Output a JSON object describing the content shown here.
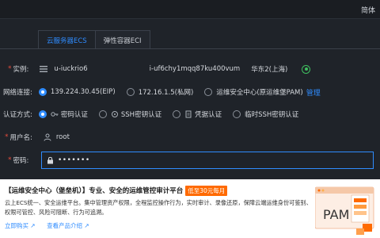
{
  "topbar": {
    "language": "简体"
  },
  "tabs": [
    {
      "label": "云服务器ECS",
      "active": true
    },
    {
      "label": "弹性容器ECI",
      "active": false
    }
  ],
  "instance": {
    "label": "实例:",
    "name": "u-iuckrio6",
    "id": "i-uf6chy1mqq87ku400vum",
    "region": "华东2(上海)"
  },
  "network": {
    "label": "网络连接:",
    "options": [
      {
        "text": "139.224.30.45(EIP)",
        "selected": true
      },
      {
        "text": "172.16.1.5(私网)",
        "selected": false
      },
      {
        "text": "运维安全中心(原运维堡PAM)",
        "selected": false
      }
    ],
    "manage_label": "管理"
  },
  "auth": {
    "label": "认证方式:",
    "options": [
      {
        "text": "密码认证",
        "selected": true
      },
      {
        "text": "SSH密钥认证",
        "selected": false
      },
      {
        "text": "凭据认证",
        "selected": false
      },
      {
        "text": "临时SSH密钥认证",
        "selected": false
      }
    ]
  },
  "user": {
    "label": "用户名:",
    "value": "root"
  },
  "password": {
    "label": "密码:",
    "value": "•••••••"
  },
  "banner": {
    "title": "【运维安全中心（堡垒机）】专业、安全的运维管控审计平台",
    "promo": "低至30元每月",
    "description": "云上ECS统一、安全运维平台。集中管理资产权限，全程监控操作行为，实时审计、录像还原，保障云端运维身份可鉴别、权限可管控、风险可阻断、行为可追溯。",
    "links": [
      "立即购买",
      "查看产品介绍"
    ]
  },
  "illustration": {
    "text": "PAM"
  },
  "colors": {
    "accent": "#2f8cff",
    "background": "#1f2329",
    "promo": "#ff6a00",
    "status_ok": "#3fbf5f",
    "required": "#e74c3c"
  }
}
